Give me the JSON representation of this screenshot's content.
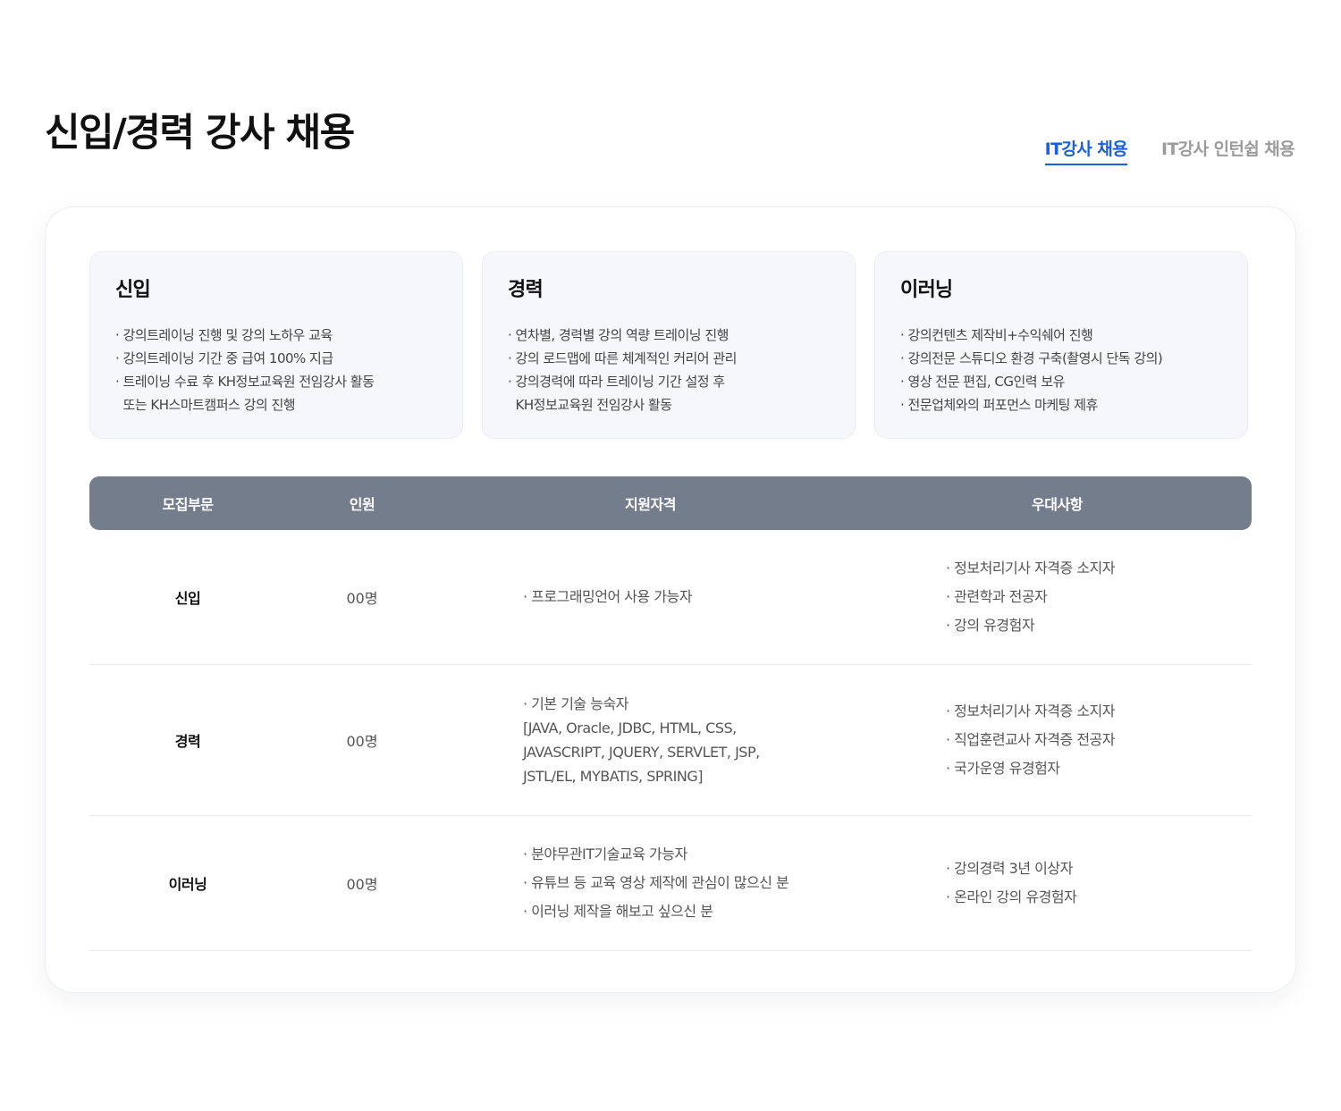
{
  "header": {
    "title": "신입/경력 강사 채용",
    "tabs": [
      {
        "label": "IT강사  채용",
        "active": true
      },
      {
        "label": "IT강사 인턴쉽 채용",
        "active": false
      }
    ]
  },
  "summary_boxes": [
    {
      "title": "신입",
      "items": [
        "· 강의트레이닝 진행 및 강의 노하우 교육",
        "· 강의트레이닝 기간 중 급여 100% 지급",
        "· 트레이닝 수료 후 KH정보교육원 전임강사 활동",
        "  또는 KH스마트캠퍼스 강의 진행"
      ]
    },
    {
      "title": "경력",
      "items": [
        "· 연차별, 경력별 강의 역량 트레이닝 진행",
        "· 강의 로드맵에 따른 체계적인 커리어 관리",
        "· 강의경력에 따라 트레이닝 기간 설정 후",
        "  KH정보교육원 전임강사 활동"
      ]
    },
    {
      "title": "이러닝",
      "items": [
        "· 강의컨텐츠 제작비+수익쉐어 진행",
        "· 강의전문 스튜디오 환경 구축(촬영시 단독 강의)",
        "· 영상 전문 편집, CG인력 보유",
        "· 전문업체와의 퍼포먼스 마케팅 제휴"
      ]
    }
  ],
  "table": {
    "headers": [
      "모집부문",
      "인원",
      "지원자격",
      "우대사항"
    ],
    "rows": [
      {
        "category": "신입",
        "count": "00명",
        "qualifications": [
          "· 프로그래밍언어 사용 가능자"
        ],
        "preferences": [
          "· 정보처리기사 자격증 소지자",
          "· 관련학과 전공자",
          "· 강의 유경험자"
        ]
      },
      {
        "category": "경력",
        "count": "00명",
        "qualifications": [
          "· 기본 기술 능숙자",
          "[JAVA, Oracle, JDBC, HTML, CSS,",
          "JAVASCRIPT, JQUERY, SERVLET, JSP,",
          "JSTL/EL, MYBATIS, SPRING]"
        ],
        "preferences": [
          "· 정보처리기사 자격증 소지자",
          "· 직업훈련교사 자격증 전공자",
          "· 국가운영 유경험자"
        ]
      },
      {
        "category": "이러닝",
        "count": "00명",
        "qualifications": [
          "· 분야무관IT기술교육 가능자",
          "· 유튜브 등 교육 영상 제작에 관심이 많으신 분",
          "· 이러닝 제작을 해보고 싶으신 분"
        ],
        "preferences": [
          "· 강의경력 3년 이상자",
          "· 온라인 강의 유경험자"
        ]
      }
    ]
  },
  "colors": {
    "accent": "#1a5fe0",
    "table_header": "#747d8c",
    "box_bg": "#f6f7fb"
  }
}
